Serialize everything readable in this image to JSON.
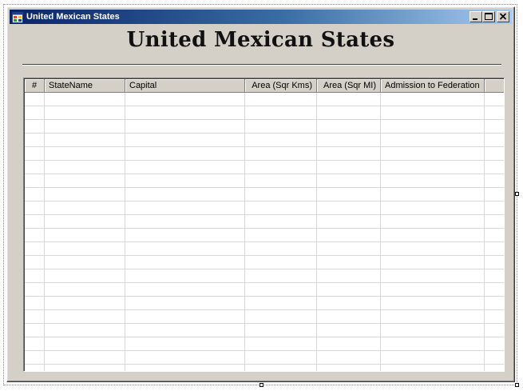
{
  "window": {
    "title": "United Mexican States",
    "controls": [
      "minimize-icon",
      "maximize-icon",
      "close-icon"
    ]
  },
  "form": {
    "heading": "United Mexican States"
  },
  "grid": {
    "columns": [
      {
        "key": "num",
        "label": "#"
      },
      {
        "key": "state",
        "label": "StateName"
      },
      {
        "key": "capital",
        "label": "Capital"
      },
      {
        "key": "area_km",
        "label": "Area (Sqr Kms)"
      },
      {
        "key": "area_mi",
        "label": "Area (Sqr MI)"
      },
      {
        "key": "admission",
        "label": "Admission to Federation"
      }
    ],
    "rows": []
  },
  "colors": {
    "titlebar_start": "#0a246a",
    "titlebar_end": "#a6caf0",
    "face": "#d4d0c8",
    "grid_line": "#d8d8d8"
  }
}
